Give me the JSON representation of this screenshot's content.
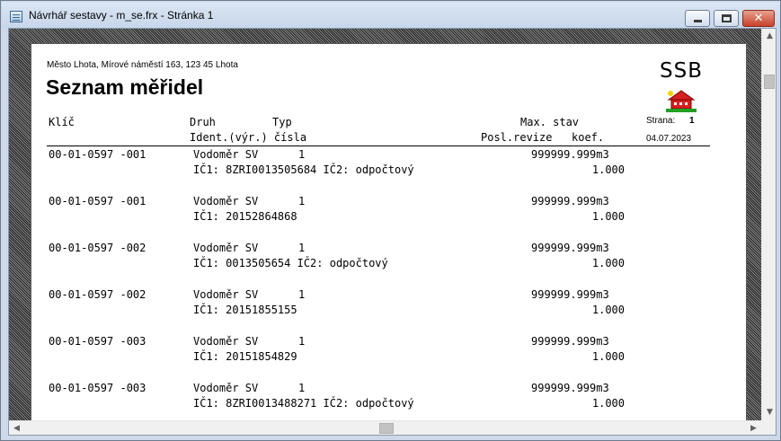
{
  "window": {
    "title": "Návrhář sestavy - m_se.frx - Stránka 1",
    "close_glyph": "✕"
  },
  "report": {
    "company": "Město Lhota, Mírové náměstí 163, 123 45 Lhota",
    "title": "Seznam měřidel",
    "logo_text": "SSB",
    "page_label": "Strana:",
    "page_number": "1",
    "date": "04.07.2023",
    "headers": {
      "key": "Klíč",
      "kind": "Druh",
      "type": "Typ",
      "ident": "Ident.(výr.) čísla",
      "max_state": "Max. stav",
      "last_revision": "Posl.revize",
      "coef": "koef."
    },
    "rows": [
      {
        "key": "00-01-0597 -001",
        "kind": "Vodoměr SV",
        "type": "1",
        "max": "999999.999m3",
        "ident": "IČ1: 8ZRI0013505684 IČ2: odpočtový",
        "coef": "1.000"
      },
      {
        "key": "00-01-0597 -001",
        "kind": "Vodoměr SV",
        "type": "1",
        "max": "999999.999m3",
        "ident": "IČ1: 20152864868",
        "coef": "1.000"
      },
      {
        "key": "00-01-0597 -002",
        "kind": "Vodoměr SV",
        "type": "1",
        "max": "999999.999m3",
        "ident": "IČ1: 0013505654 IČ2: odpočtový",
        "coef": "1.000"
      },
      {
        "key": "00-01-0597 -002",
        "kind": "Vodoměr SV",
        "type": "1",
        "max": "999999.999m3",
        "ident": "IČ1: 20151855155",
        "coef": "1.000"
      },
      {
        "key": "00-01-0597 -003",
        "kind": "Vodoměr SV",
        "type": "1",
        "max": "999999.999m3",
        "ident": "IČ1: 20151854829",
        "coef": "1.000"
      },
      {
        "key": "00-01-0597 -003",
        "kind": "Vodoměr SV",
        "type": "1",
        "max": "999999.999m3",
        "ident": "IČ1: 8ZRI0013488271 IČ2: odpočtový",
        "coef": "1.000"
      }
    ]
  },
  "scrollbars": {
    "up": "▲",
    "down": "▼",
    "left": "◀",
    "right": "▶"
  },
  "colors": {
    "titlebar": "#dbe6f4",
    "close_button": "#c7412a",
    "house_roof": "#d42020",
    "house_grass": "#22a022",
    "sun": "#f2d200"
  }
}
